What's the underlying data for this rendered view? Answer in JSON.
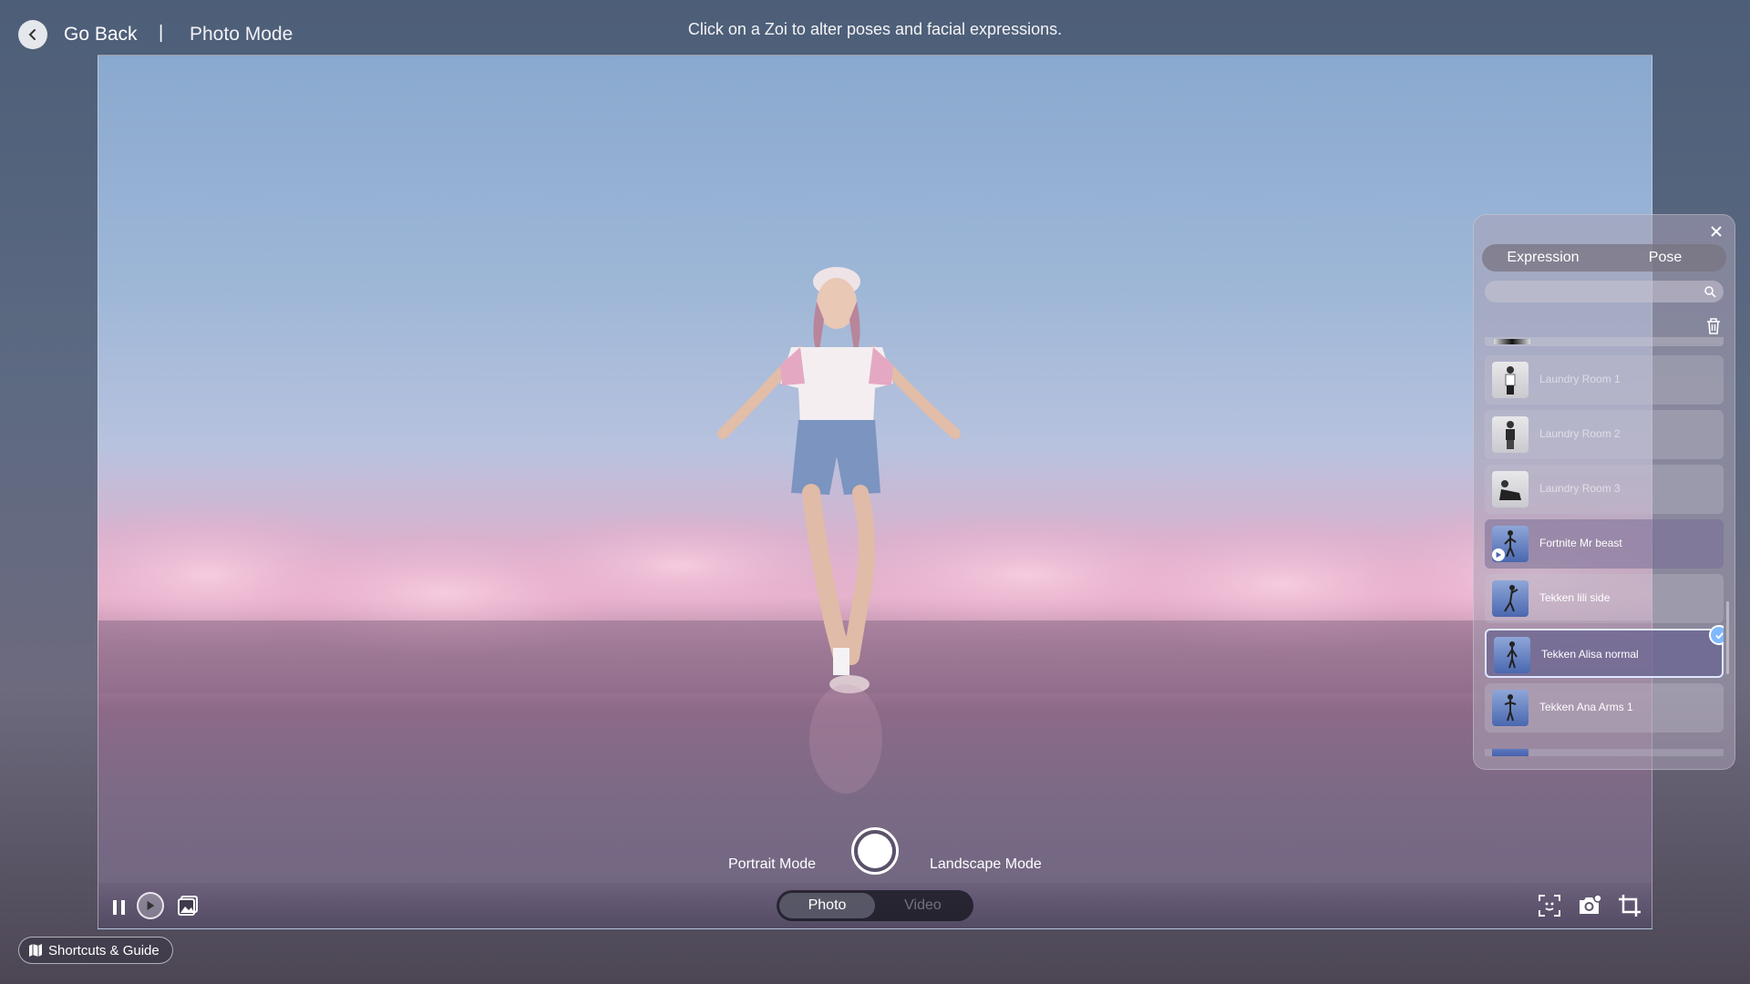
{
  "top_bar": {
    "go_back": "Go Back",
    "separator": "|",
    "title": "Photo Mode",
    "hint": "Click on a Zoi to alter poses and facial expressions."
  },
  "capture": {
    "portrait_mode": "Portrait Mode",
    "landscape_mode": "Landscape Mode",
    "segments": [
      "Photo",
      "Video"
    ],
    "active_segment": "Photo"
  },
  "panel": {
    "tabs": [
      "Expression",
      "Pose"
    ],
    "search_placeholder": "",
    "poses": [
      {
        "label": "Laundry Room 1",
        "state": "dim"
      },
      {
        "label": "Laundry Room 2",
        "state": "dim"
      },
      {
        "label": "Laundry Room 3",
        "state": "dim"
      },
      {
        "label": "Fortnite Mr beast",
        "state": "highlight"
      },
      {
        "label": "Tekken lili side",
        "state": "normal"
      },
      {
        "label": "Tekken Alisa normal",
        "state": "selected"
      },
      {
        "label": "Tekken Ana Arms 1",
        "state": "normal"
      }
    ]
  },
  "footer": {
    "shortcuts": "Shortcuts & Guide"
  },
  "icons": {
    "back": "chevron-left-icon",
    "pause": "pause-icon",
    "play": "play-icon",
    "gallery": "gallery-icon",
    "face_scan": "face-scan-icon",
    "camera_settings": "camera-settings-icon",
    "crop": "crop-icon",
    "close": "close-icon",
    "search": "search-icon",
    "trash": "trash-icon",
    "guide": "map-icon"
  }
}
